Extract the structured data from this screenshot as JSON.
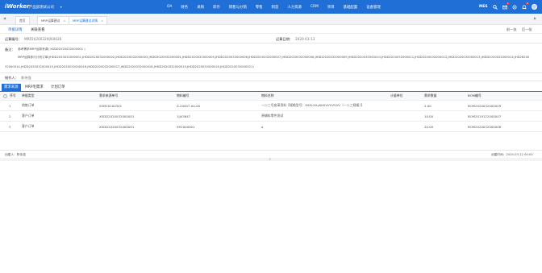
{
  "header": {
    "logo": "iWorker",
    "company": "产品部测试公司",
    "company_caret": "▾",
    "nav": [
      "OA",
      "财务",
      "采购",
      "库存",
      "销售与分销",
      "零售",
      "制造",
      "人力资源",
      "CRM",
      "项目",
      "基础配置",
      "设备管理"
    ],
    "mes": "MES",
    "badges": {
      "mail": "1",
      "bell": "9"
    },
    "colors": {
      "primary": "#1f6fd6"
    }
  },
  "tabs": {
    "prev": "◀",
    "next": "▶",
    "items": [
      {
        "label": "首页",
        "closable": false,
        "active": false
      },
      {
        "label": "MRP运算建议",
        "closable": true,
        "active": false
      },
      {
        "label": "MRP运算建议详情",
        "closable": true,
        "active": true
      }
    ],
    "close_glyph": "×"
  },
  "subheader": {
    "detail": "单据详情",
    "related": "关联查看",
    "prev": "前一张",
    "next": "后一张"
  },
  "form": {
    "doc_no_label": "运算编号：",
    "doc_no": "MRP20200320000026",
    "date_label": "运算日期：",
    "date": "2020-03-13"
  },
  "remarks": {
    "label": "备注：",
    "lines": [
      "参考需求MRP运算来源( XSDD2020032000001 )",
      "MRP运算参与计划订单(JHDD2020032000001,JHDD2020032000002,JHDD2020032000003,JHDD2020032000004,JHDD2020032000005,JHDD2020032000006,JHDD2020032000007,JHDD2020032000008,JHDD2020032000009,JHDD2020032000010,JHDD2020032000011,JHDD2020032000012,JHDD2020032000013,JHDD2020032000014,JHD28200",
      "32000014,JHDD2020032000015,JHDD2020032000016,JHDD2020032000017,JHDD2020032000018,JHDD2020032000019,JHDD2020032000020,JHDD2020032000021)"
    ]
  },
  "maker": {
    "label": "制作人：",
    "value": "陈伟强"
  },
  "detail_tabs": [
    "需求来源",
    "MRP毛需求",
    "计划订单"
  ],
  "table": {
    "headers": [
      "序号",
      "单据类型",
      "需求来源单号",
      "物料编号",
      "物料名称",
      "计量单位",
      "需求数量",
      "BOM编号"
    ],
    "rows": [
      [
        "1",
        "销售订单",
        "SSM20200301",
        "Z-20007-00-00",
        "一二三号皮革用料【规格型号：KSM-XXyKKKVVVVVVV（一二三规格）】",
        "",
        "2.00",
        "BOM2020032000009"
      ],
      [
        "2",
        "客户订单",
        "XSDD2020032000001",
        "1JJ43647",
        "原辅料零件测试",
        "",
        "10.00",
        "BOM2019122400007"
      ],
      [
        "3",
        "客户订单",
        "XSDD2020032000001",
        "SR1000001",
        "a",
        "",
        "20.00",
        "BOM2020032000008"
      ]
    ]
  },
  "footer": {
    "creator": "创建人：陈伟强",
    "created": "创建时间：2020-03-12 00:00"
  },
  "resize_glyph": "⇕"
}
